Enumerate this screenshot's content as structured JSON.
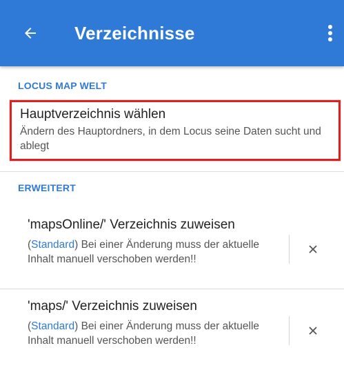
{
  "appbar": {
    "title": "Verzeichnisse",
    "back_icon": "arrow-left-icon",
    "menu_icon": "more-vert-icon",
    "color": "#2f7ad6"
  },
  "sections": [
    {
      "header": "LOCUS MAP WELT",
      "items": [
        {
          "title": "Hauptverzeichnis wählen",
          "summary": "Ändern des Hauptordners, in dem Locus seine Daten sucht und ablegt",
          "highlighted": true,
          "highlight_color": "#e02020"
        }
      ]
    },
    {
      "header": "ERWEITERT",
      "items": [
        {
          "title": "'mapsOnline/' Verzeichnis zuweisen",
          "summary_paren_open": "(",
          "summary_tag": "Standard",
          "summary_paren_close": ")",
          "summary_rest": " Bei einer Änderung muss der aktuelle Inhalt manuell verschoben werden!!",
          "action_icon": "close-icon"
        },
        {
          "title": "'maps/' Verzeichnis zuweisen",
          "summary_paren_open": "(",
          "summary_tag": "Standard",
          "summary_paren_close": ")",
          "summary_rest": " Bei einer Änderung muss der aktuelle Inhalt manuell verschoben werden!!",
          "action_icon": "close-icon"
        }
      ]
    }
  ]
}
